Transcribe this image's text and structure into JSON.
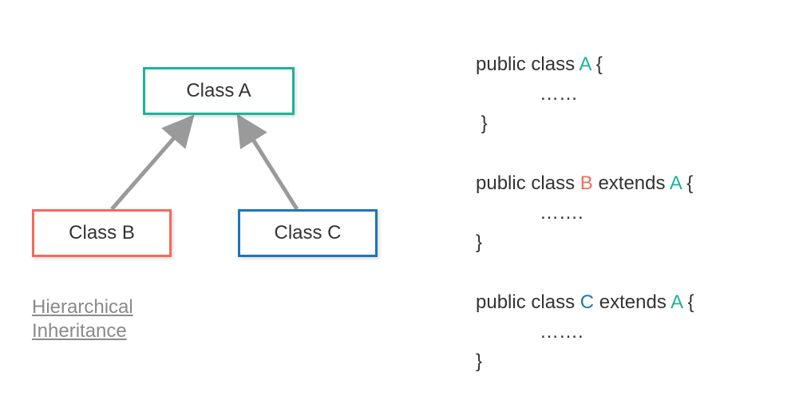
{
  "diagram": {
    "boxes": {
      "a": "Class A",
      "b": "Class B",
      "c": "Class C"
    },
    "caption_line1": "Hierarchical",
    "caption_line2": "Inheritance"
  },
  "code": {
    "kw_public": "public",
    "kw_class": "class",
    "kw_extends": "extends",
    "name_a": "A",
    "name_b": "B",
    "name_c": "C",
    "brace_open": "{",
    "brace_close": "}",
    "ellipsis6": "……",
    "ellipsis7": "……."
  },
  "chart_data": {
    "type": "diagram",
    "title": "Hierarchical Inheritance",
    "nodes": [
      {
        "id": "A",
        "label": "Class A"
      },
      {
        "id": "B",
        "label": "Class B"
      },
      {
        "id": "C",
        "label": "Class C"
      }
    ],
    "edges": [
      {
        "from": "B",
        "to": "A",
        "relation": "extends"
      },
      {
        "from": "C",
        "to": "A",
        "relation": "extends"
      }
    ],
    "code_snippets": [
      "public class A { …… }",
      "public class B extends A { ……. }",
      "public class C extends A { ……. }"
    ]
  }
}
